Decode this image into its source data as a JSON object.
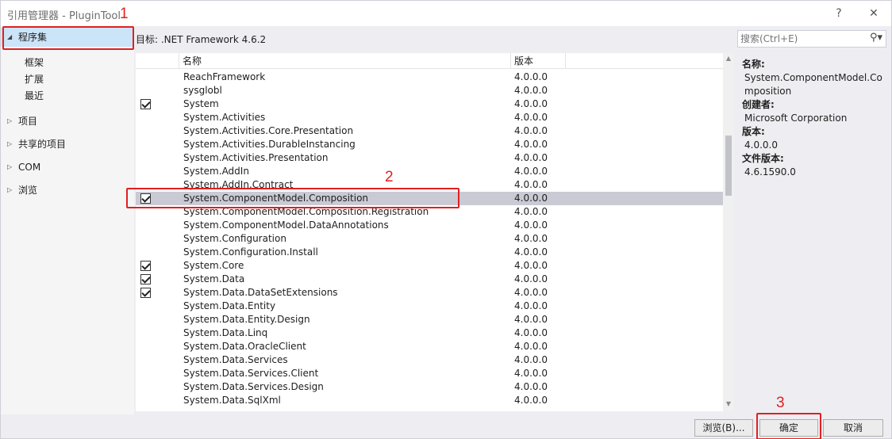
{
  "window": {
    "title": "引用管理器 - PluginTool",
    "help_glyph": "?",
    "close_glyph": "✕"
  },
  "sidebar": {
    "assemblies": "程序集",
    "sub_items": [
      "框架",
      "扩展",
      "最近"
    ],
    "items": [
      "项目",
      "共享的项目",
      "COM",
      "浏览"
    ]
  },
  "target_label": "目标: .NET Framework 4.6.2",
  "list": {
    "columns": [
      "名称",
      "版本"
    ],
    "rows": [
      {
        "name": "ReachFramework",
        "version": "4.0.0.0",
        "checked": false
      },
      {
        "name": "sysglobl",
        "version": "4.0.0.0",
        "checked": false
      },
      {
        "name": "System",
        "version": "4.0.0.0",
        "checked": true
      },
      {
        "name": "System.Activities",
        "version": "4.0.0.0",
        "checked": false
      },
      {
        "name": "System.Activities.Core.Presentation",
        "version": "4.0.0.0",
        "checked": false
      },
      {
        "name": "System.Activities.DurableInstancing",
        "version": "4.0.0.0",
        "checked": false
      },
      {
        "name": "System.Activities.Presentation",
        "version": "4.0.0.0",
        "checked": false
      },
      {
        "name": "System.AddIn",
        "version": "4.0.0.0",
        "checked": false
      },
      {
        "name": "System.AddIn.Contract",
        "version": "4.0.0.0",
        "checked": false
      },
      {
        "name": "System.ComponentModel.Composition",
        "version": "4.0.0.0",
        "checked": true,
        "selected": true
      },
      {
        "name": "System.ComponentModel.Composition.Registration",
        "version": "4.0.0.0",
        "checked": false
      },
      {
        "name": "System.ComponentModel.DataAnnotations",
        "version": "4.0.0.0",
        "checked": false
      },
      {
        "name": "System.Configuration",
        "version": "4.0.0.0",
        "checked": false
      },
      {
        "name": "System.Configuration.Install",
        "version": "4.0.0.0",
        "checked": false
      },
      {
        "name": "System.Core",
        "version": "4.0.0.0",
        "checked": true
      },
      {
        "name": "System.Data",
        "version": "4.0.0.0",
        "checked": true
      },
      {
        "name": "System.Data.DataSetExtensions",
        "version": "4.0.0.0",
        "checked": true
      },
      {
        "name": "System.Data.Entity",
        "version": "4.0.0.0",
        "checked": false
      },
      {
        "name": "System.Data.Entity.Design",
        "version": "4.0.0.0",
        "checked": false
      },
      {
        "name": "System.Data.Linq",
        "version": "4.0.0.0",
        "checked": false
      },
      {
        "name": "System.Data.OracleClient",
        "version": "4.0.0.0",
        "checked": false
      },
      {
        "name": "System.Data.Services",
        "version": "4.0.0.0",
        "checked": false
      },
      {
        "name": "System.Data.Services.Client",
        "version": "4.0.0.0",
        "checked": false
      },
      {
        "name": "System.Data.Services.Design",
        "version": "4.0.0.0",
        "checked": false
      },
      {
        "name": "System.Data.SqlXml",
        "version": "4.0.0.0",
        "checked": false
      }
    ]
  },
  "search": {
    "placeholder": "搜索(Ctrl+E)"
  },
  "details": {
    "name_label": "名称:",
    "name_value": "System.ComponentModel.Composition",
    "creator_label": "创建者:",
    "creator_value": "Microsoft Corporation",
    "version_label": "版本:",
    "version_value": "4.0.0.0",
    "file_version_label": "文件版本:",
    "file_version_value": "4.6.1590.0"
  },
  "buttons": {
    "browse": "浏览(B)...",
    "ok": "确定",
    "cancel": "取消"
  },
  "annotations": [
    "1",
    "2",
    "3"
  ],
  "colors": {
    "annotation": "#e02020",
    "selected_row": "#cacad4",
    "selected_sidebar": "#cce4f7"
  }
}
